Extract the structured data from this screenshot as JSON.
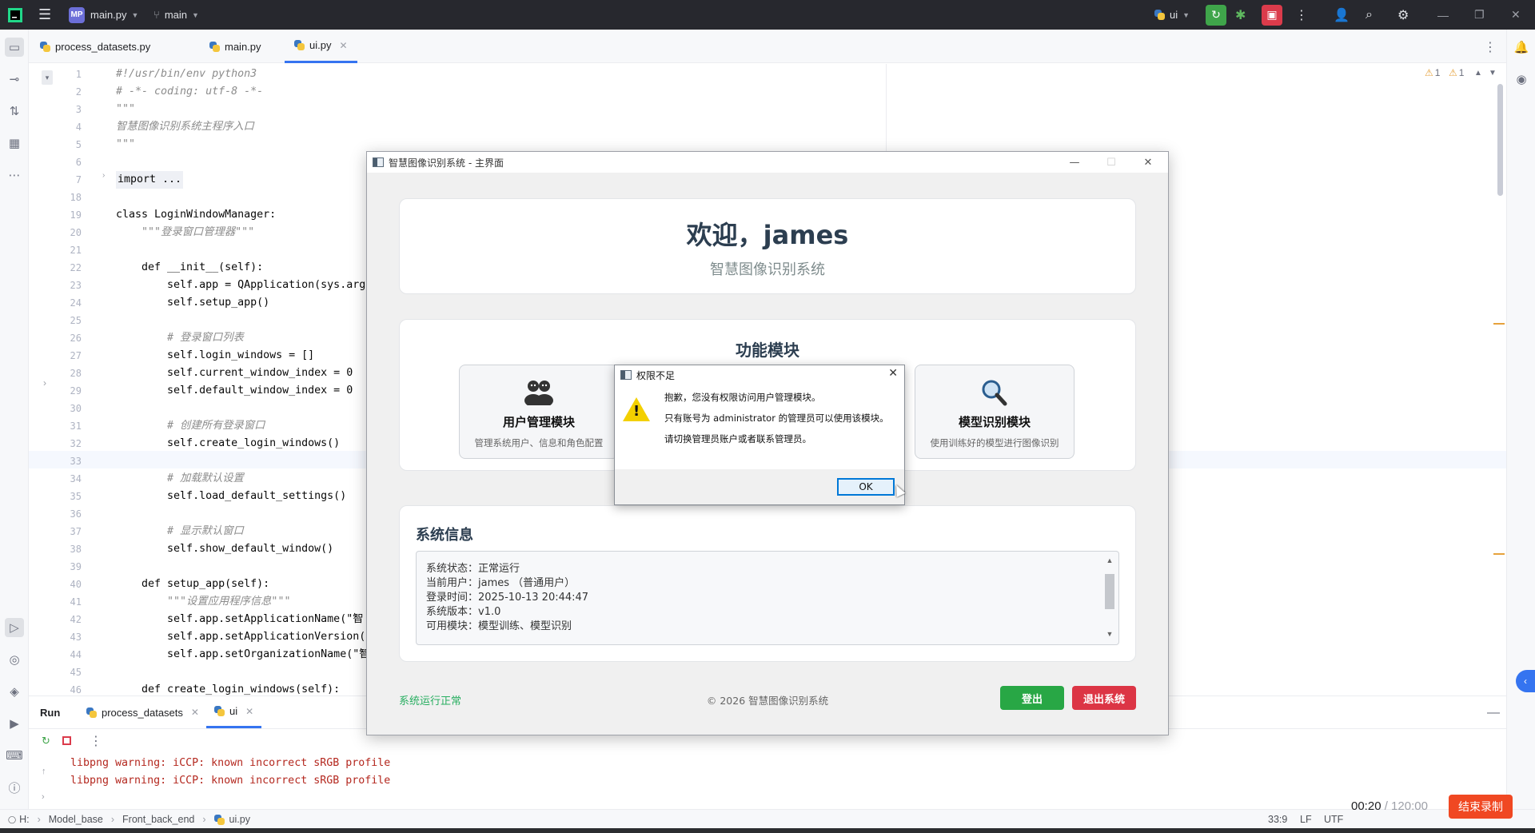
{
  "ide": {
    "project_badge": "MP",
    "project_name": "main.py",
    "branch": "main",
    "run_config": "ui",
    "colors": {
      "accent": "#3574f0",
      "topbar": "#27282e",
      "run_green": "#3fa54a",
      "stop_red": "#db3b4b"
    }
  },
  "editor_tabs": [
    {
      "label": "process_datasets.py"
    },
    {
      "label": "main.py"
    },
    {
      "label": "ui.py"
    }
  ],
  "code_lines": [
    {
      "n": "1",
      "text": "#!/usr/bin/env python3"
    },
    {
      "n": "2",
      "text": "# -*- coding: utf-8 -*-"
    },
    {
      "n": "3",
      "text": "\"\"\""
    },
    {
      "n": "4",
      "text": "智慧图像识别系统主程序入口"
    },
    {
      "n": "5",
      "text": "\"\"\""
    },
    {
      "n": "6",
      "text": ""
    },
    {
      "n": "7",
      "text": "import ..."
    },
    {
      "n": "18",
      "text": ""
    },
    {
      "n": "19",
      "text": "class LoginWindowManager:"
    },
    {
      "n": "20",
      "text": "    \"\"\"登录窗口管理器\"\"\""
    },
    {
      "n": "21",
      "text": ""
    },
    {
      "n": "22",
      "text": "    def __init__(self):"
    },
    {
      "n": "23",
      "text": "        self.app = QApplication(sys.arg"
    },
    {
      "n": "24",
      "text": "        self.setup_app()"
    },
    {
      "n": "25",
      "text": ""
    },
    {
      "n": "26",
      "text": "        # 登录窗口列表"
    },
    {
      "n": "27",
      "text": "        self.login_windows = []"
    },
    {
      "n": "28",
      "text": "        self.current_window_index = 0"
    },
    {
      "n": "29",
      "text": "        self.default_window_index = 0"
    },
    {
      "n": "30",
      "text": ""
    },
    {
      "n": "31",
      "text": "        # 创建所有登录窗口"
    },
    {
      "n": "32",
      "text": "        self.create_login_windows()"
    },
    {
      "n": "33",
      "text": ""
    },
    {
      "n": "34",
      "text": "        # 加载默认设置"
    },
    {
      "n": "35",
      "text": "        self.load_default_settings()"
    },
    {
      "n": "36",
      "text": ""
    },
    {
      "n": "37",
      "text": "        # 显示默认窗口"
    },
    {
      "n": "38",
      "text": "        self.show_default_window()"
    },
    {
      "n": "39",
      "text": ""
    },
    {
      "n": "40",
      "text": "    def setup_app(self):"
    },
    {
      "n": "41",
      "text": "        \"\"\"设置应用程序信息\"\"\""
    },
    {
      "n": "42",
      "text": "        self.app.setApplicationName(\"智"
    },
    {
      "n": "43",
      "text": "        self.app.setApplicationVersion("
    },
    {
      "n": "44",
      "text": "        self.app.setOrganizationName(\"智"
    },
    {
      "n": "45",
      "text": ""
    },
    {
      "n": "46",
      "text": "    def create_login_windows(self):"
    }
  ],
  "inspections": {
    "warnings": "1",
    "weak_warnings": "1"
  },
  "run_panel": {
    "title": "Run",
    "tabs": [
      {
        "label": "process_datasets"
      },
      {
        "label": "ui"
      }
    ],
    "output": [
      "libpng warning: iCCP: known incorrect sRGB profile",
      "libpng warning: iCCP: known incorrect sRGB profile"
    ]
  },
  "status_bar": {
    "path": [
      "H:",
      "Model_base",
      "Front_back_end",
      "ui.py"
    ],
    "caret": "33:9",
    "line_sep": "LF",
    "encoding": "UTF"
  },
  "recording": {
    "elapsed": "00:20",
    "total": "/ 120:00",
    "stop_label": "结束录制"
  },
  "app": {
    "window_title": "智慧图像识别系统 - 主界面",
    "welcome": "欢迎，james",
    "subtitle": "智慧图像识别系统",
    "modules_title": "功能模块",
    "modules": [
      {
        "icon": "users-icon",
        "title": "用户管理模块",
        "desc": "管理系统用户、信息和角色配置"
      },
      {
        "icon": "magnifier-icon",
        "title": "模型识别模块",
        "desc": "使用训练好的模型进行图像识别"
      }
    ],
    "sysinfo_title": "系统信息",
    "sysinfo_lines": [
      "系统状态：正常运行",
      "当前用户：james （普通用户）",
      "登录时间：2025-10-13 20:44:47",
      "系统版本：v1.0",
      "可用模块：模型训练、模型识别"
    ],
    "status_text": "系统运行正常",
    "copyright": "© 2026 智慧图像识别系统",
    "logout_label": "登出",
    "exit_label": "退出系统"
  },
  "dialog": {
    "title": "权限不足",
    "lines": [
      "抱歉，您没有权限访问用户管理模块。",
      "只有账号为 administrator 的管理员可以使用该模块。",
      "请切换管理员账户或者联系管理员。"
    ],
    "ok_label": "OK"
  }
}
